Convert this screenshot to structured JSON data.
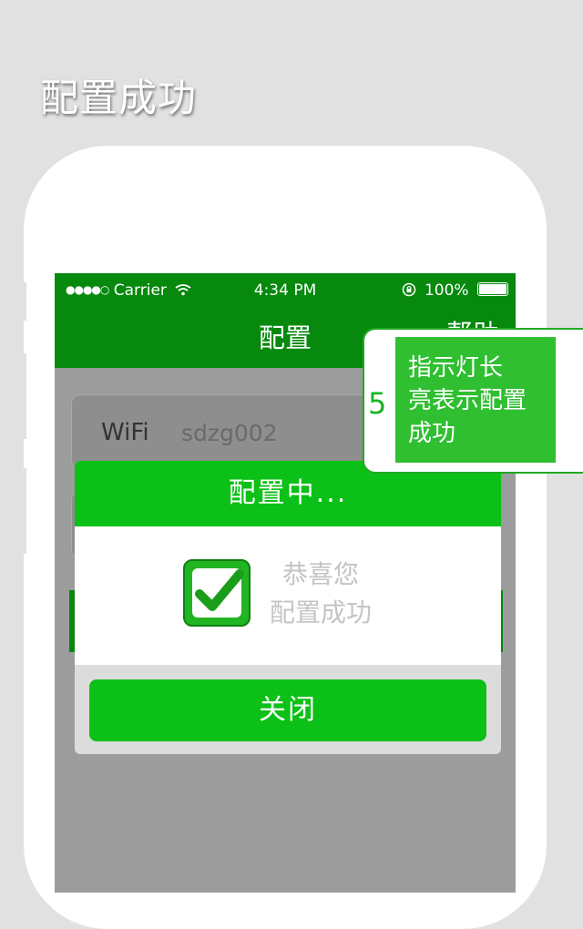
{
  "headline": "配置成功",
  "status_bar": {
    "signal": "●●●●○",
    "carrier": "Carrier",
    "time": "4:34 PM",
    "battery": "100%"
  },
  "navbar": {
    "title": "配置",
    "right": "帮助"
  },
  "form": {
    "wifi_label": "WiFi",
    "wifi_value": "sdzg002"
  },
  "dialog": {
    "title": "配置中...",
    "message_line1": "恭喜您",
    "message_line2": "配置成功",
    "close_label": "关闭"
  },
  "callout": {
    "number": "5",
    "text_line1": "指示灯长",
    "text_line2": "亮表示配置",
    "text_line3": "成功"
  },
  "colors": {
    "nav_green": "#06890d",
    "accent_green": "#0bc016",
    "callout_green": "#2fbf31"
  }
}
